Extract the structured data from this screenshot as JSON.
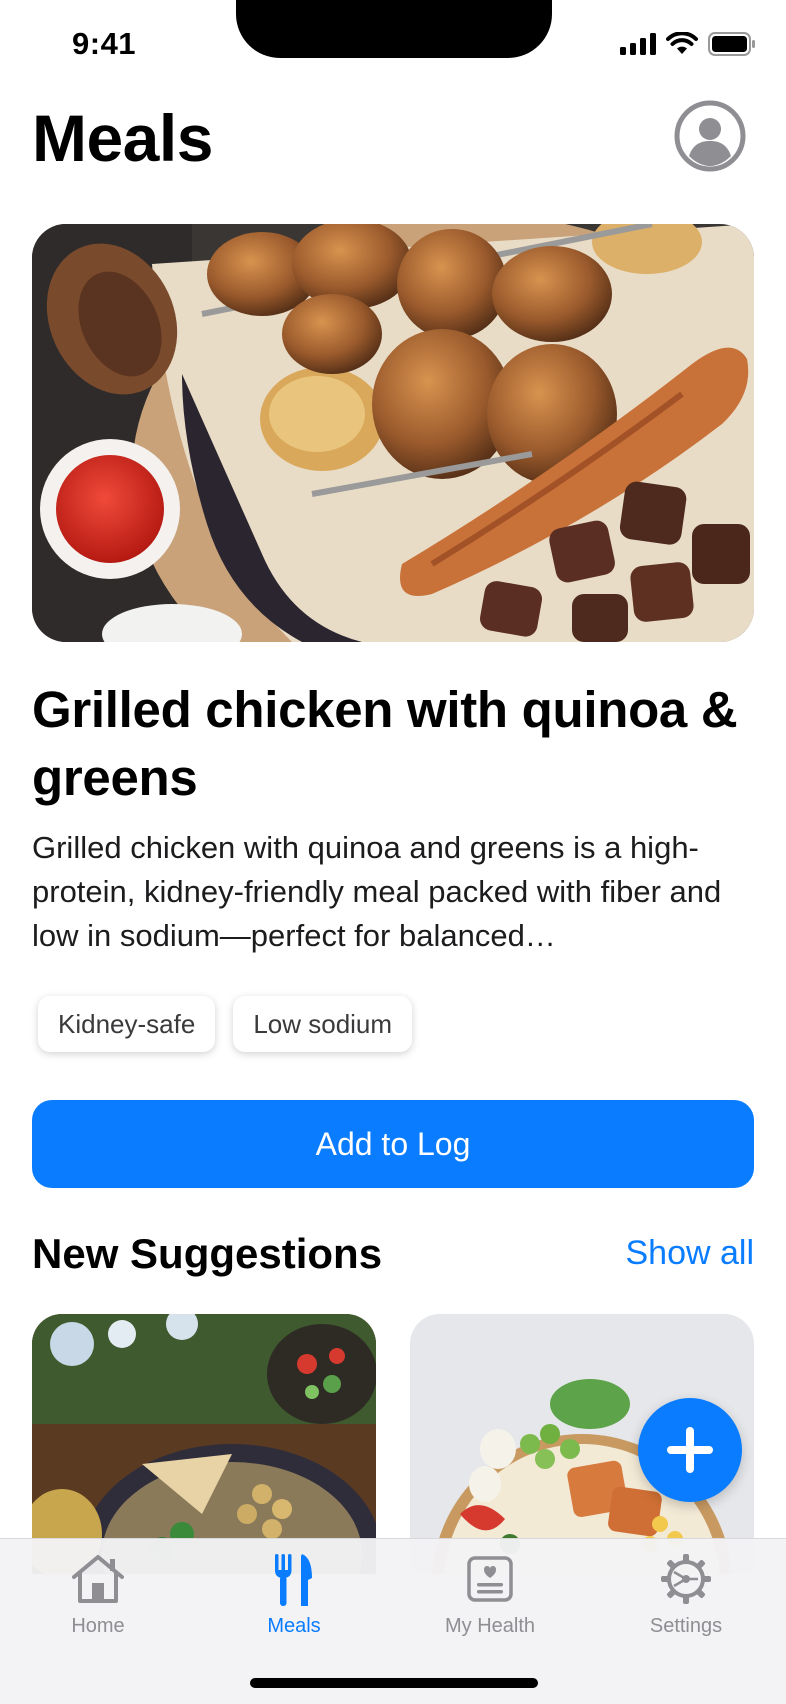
{
  "status_bar": {
    "time": "9:41"
  },
  "header": {
    "title": "Meals"
  },
  "featured": {
    "title": "Grilled chicken with quinoa & greens",
    "description": "Grilled chicken with quinoa and greens is a high-protein, kidney-friendly meal packed with fiber and low in sodium—perfect for balanced…",
    "tags": [
      "Kidney-safe",
      "Low sodium"
    ],
    "add_button": "Add to Log"
  },
  "suggestions": {
    "title": "New Suggestions",
    "show_all": "Show all"
  },
  "tab_bar": {
    "tabs": [
      {
        "label": "Home",
        "icon": "home-icon",
        "active": false
      },
      {
        "label": "Meals",
        "icon": "fork-knife-icon",
        "active": true
      },
      {
        "label": "My Health",
        "icon": "health-record-icon",
        "active": false
      },
      {
        "label": "Settings",
        "icon": "gear-icon",
        "active": false
      }
    ]
  },
  "colors": {
    "accent": "#0a7cff",
    "inactive": "#8e8e93"
  }
}
